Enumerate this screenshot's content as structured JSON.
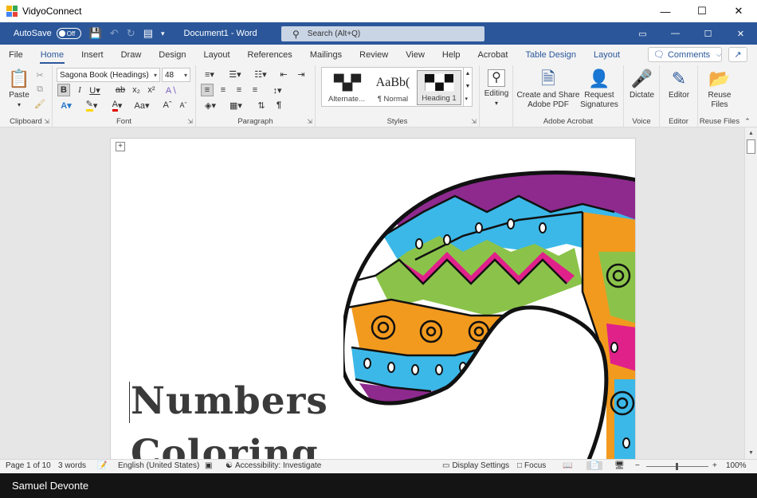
{
  "app": {
    "name": "VidyoConnect",
    "logo_colors": [
      "#f4b400",
      "#34a853",
      "#4285f4",
      "#ea4335"
    ]
  },
  "window_controls": {
    "minimize": "—",
    "maximize": "☐",
    "close": "✕"
  },
  "word_bar": {
    "autosave_label": "AutoSave",
    "autosave_state": "Off",
    "doc_title": "Document1  -  Word",
    "search_placeholder": "Search (Alt+Q)",
    "accent": "#2b579a"
  },
  "tabs": [
    "File",
    "Home",
    "Insert",
    "Draw",
    "Design",
    "Layout",
    "References",
    "Mailings",
    "Review",
    "View",
    "Help",
    "Acrobat",
    "Table Design",
    "Layout"
  ],
  "active_tab": "Home",
  "comments_label": "Comments",
  "ribbon": {
    "clipboard": {
      "label": "Clipboard",
      "paste": "Paste"
    },
    "font": {
      "label": "Font",
      "font_name": "Sagona Book (Headings)",
      "font_size": "48"
    },
    "paragraph": {
      "label": "Paragraph"
    },
    "styles": {
      "label": "Styles",
      "items": [
        "Alternate...",
        "¶ Normal",
        "Heading 1"
      ],
      "samples": [
        "",
        "AaBb(",
        ""
      ]
    },
    "editing": {
      "label": "Editing"
    },
    "adobe": {
      "label": "Adobe Acrobat",
      "create_share": "Create and Share Adobe PDF",
      "request_sig": "Request Signatures"
    },
    "voice": {
      "label": "Voice",
      "dictate": "Dictate"
    },
    "editor": {
      "label": "Editor",
      "editor_btn": "Editor"
    },
    "reuse": {
      "label": "Reuse Files",
      "reuse_btn": "Reuse Files"
    }
  },
  "document": {
    "line1": "Numbers",
    "line2": "Coloring"
  },
  "status_bar": {
    "page": "Page 1 of 10",
    "words": "3 words",
    "language": "English (United States)",
    "accessibility": "Accessibility: Investigate",
    "display_settings": "Display Settings",
    "focus": "Focus",
    "zoom": "100%",
    "zoom_minus": "−",
    "zoom_plus": "+"
  },
  "taskbar": {
    "user_name": "Samuel Devonte"
  }
}
